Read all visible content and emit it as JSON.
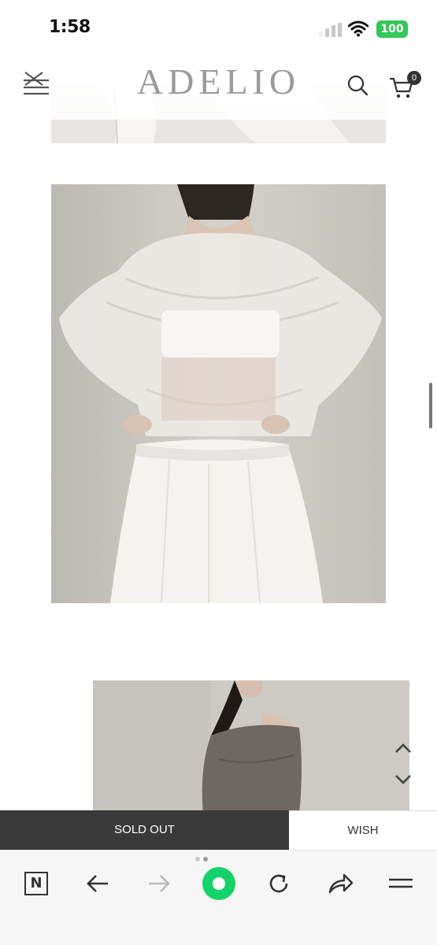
{
  "status_bar": {
    "time": "1:58",
    "battery": "100"
  },
  "header": {
    "logo": "ADELIO",
    "cart_count": "0"
  },
  "actions": {
    "sold_out_label": "SOLD OUT",
    "wish_label": "WISH"
  },
  "toolbar": {
    "naver_label": "N"
  },
  "icons": {
    "menu": "hamburger-close-icon",
    "search": "search-icon",
    "cart": "cart-icon",
    "back": "arrow-left-icon",
    "forward": "arrow-right-icon",
    "home": "green-circle-icon",
    "reload": "reload-icon",
    "share": "share-icon",
    "more": "menu-icon"
  },
  "colors": {
    "sold_out_bg": "#3a3a3a",
    "home_green": "#13d36a",
    "battery_green": "#34c759"
  }
}
